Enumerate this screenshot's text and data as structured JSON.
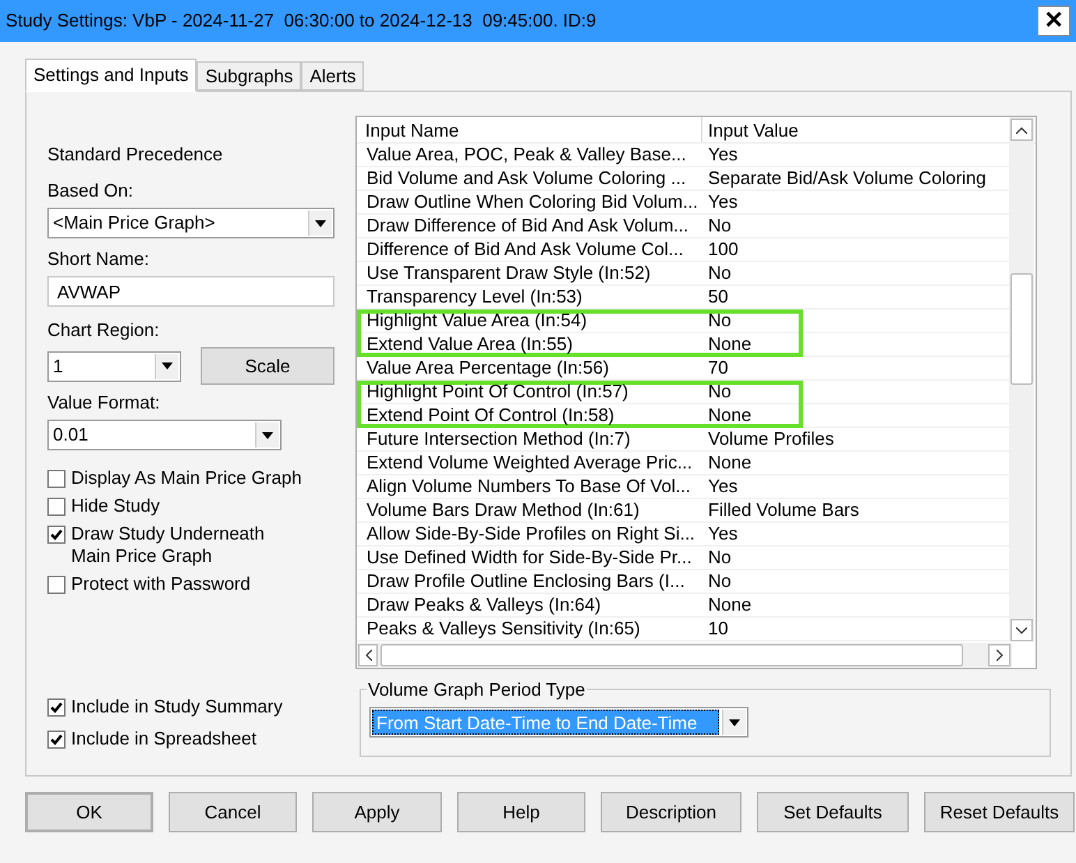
{
  "window": {
    "title": "Study Settings: VbP - 2024-11-27  06:30:00 to 2024-12-13  09:45:00. ID:9",
    "close": "✕"
  },
  "tabs": [
    {
      "label": "Settings and Inputs",
      "selected": true
    },
    {
      "label": "Subgraphs",
      "selected": false
    },
    {
      "label": "Alerts",
      "selected": false
    }
  ],
  "left": {
    "precedence": "Standard Precedence",
    "based_on": {
      "label": "Based On:",
      "value": "<Main Price Graph>"
    },
    "short_name": {
      "label": "Short Name:",
      "value": "AVWAP"
    },
    "chart_region": {
      "label": "Chart Region:",
      "value": "1",
      "button": "Scale"
    },
    "value_format": {
      "label": "Value Format:",
      "value": "0.01"
    },
    "checkboxes": [
      {
        "label": "Display As Main Price Graph",
        "checked": false
      },
      {
        "label": "Hide Study",
        "checked": false
      },
      {
        "label": "Draw Study Underneath Main Price Graph",
        "checked": true
      },
      {
        "label": "Protect with Password",
        "checked": false
      }
    ],
    "bottom_checkboxes": [
      {
        "label": "Include in Study Summary",
        "checked": true
      },
      {
        "label": "Include in Spreadsheet",
        "checked": true
      }
    ]
  },
  "inputs": {
    "columns": [
      "Input Name",
      "Input Value"
    ],
    "rows": [
      {
        "name": "Value Area, POC, Peak & Valley Base...",
        "value": "Yes",
        "highlighted": false
      },
      {
        "name": "Bid Volume and Ask Volume Coloring ...",
        "value": "Separate Bid/Ask Volume Coloring",
        "highlighted": false
      },
      {
        "name": "Draw Outline When Coloring Bid Volum...",
        "value": "Yes",
        "highlighted": false
      },
      {
        "name": "Draw Difference of Bid And Ask Volum...",
        "value": "No",
        "highlighted": false
      },
      {
        "name": "Difference of Bid And Ask Volume Col...",
        "value": "100",
        "highlighted": false
      },
      {
        "name": "Use Transparent Draw Style   (In:52)",
        "value": "No",
        "highlighted": false
      },
      {
        "name": "Transparency Level   (In:53)",
        "value": "50",
        "highlighted": false
      },
      {
        "name": "Highlight Value Area   (In:54)",
        "value": "No",
        "highlighted": true
      },
      {
        "name": "Extend Value Area   (In:55)",
        "value": "None",
        "highlighted": true
      },
      {
        "name": "Value Area Percentage   (In:56)",
        "value": "70",
        "highlighted": false
      },
      {
        "name": "Highlight Point Of Control   (In:57)",
        "value": "No",
        "highlighted": true
      },
      {
        "name": "Extend Point Of Control   (In:58)",
        "value": "None",
        "highlighted": true
      },
      {
        "name": "Future Intersection Method   (In:7)",
        "value": "Volume Profiles",
        "highlighted": false
      },
      {
        "name": "Extend Volume Weighted Average Pric...",
        "value": "None",
        "highlighted": false
      },
      {
        "name": "Align Volume Numbers To Base Of Vol...",
        "value": "Yes",
        "highlighted": false
      },
      {
        "name": "Volume Bars Draw Method   (In:61)",
        "value": "Filled Volume Bars",
        "highlighted": false
      },
      {
        "name": "Allow Side-By-Side Profiles on Right Si...",
        "value": "Yes",
        "highlighted": false
      },
      {
        "name": "Use Defined Width for Side-By-Side Pr...",
        "value": "No",
        "highlighted": false
      },
      {
        "name": "Draw Profile Outline Enclosing Bars   (I...",
        "value": "No",
        "highlighted": false
      },
      {
        "name": "Draw Peaks & Valleys   (In:64)",
        "value": "None",
        "highlighted": false
      },
      {
        "name": "Peaks & Valleys Sensitivity   (In:65)",
        "value": "10",
        "highlighted": false
      }
    ]
  },
  "period_type": {
    "label": "Volume Graph Period Type",
    "value": "From Start Date-Time to End Date-Time"
  },
  "buttons": [
    "OK",
    "Cancel",
    "Apply",
    "Help",
    "Description",
    "Set Defaults",
    "Reset Defaults"
  ]
}
